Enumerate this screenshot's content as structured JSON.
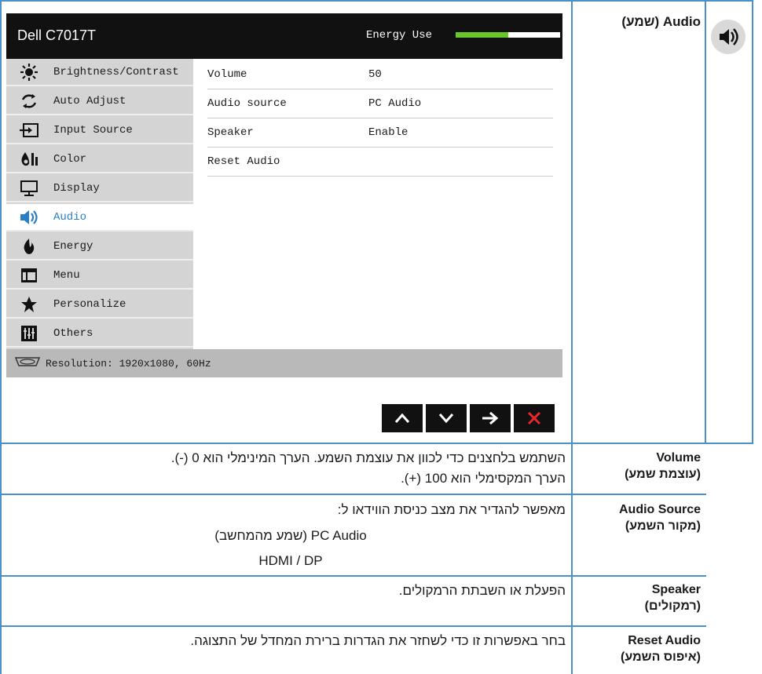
{
  "header": {
    "title": "Audio (שמע)",
    "icon": "speaker-icon"
  },
  "osd": {
    "brand": "Dell C7017T",
    "energy_label": "Energy Use",
    "energy_level": 0.5,
    "accent": "#6ac62a",
    "menu": [
      {
        "label": "Brightness/Contrast",
        "icon": "brightness-icon"
      },
      {
        "label": "Auto Adjust",
        "icon": "auto-adjust-icon"
      },
      {
        "label": "Input Source",
        "icon": "input-source-icon"
      },
      {
        "label": "Color",
        "icon": "color-icon"
      },
      {
        "label": "Display",
        "icon": "display-icon"
      },
      {
        "label": "Audio",
        "icon": "audio-icon",
        "active": true
      },
      {
        "label": "Energy",
        "icon": "energy-icon"
      },
      {
        "label": "Menu",
        "icon": "menu-icon"
      },
      {
        "label": "Personalize",
        "icon": "star-icon"
      },
      {
        "label": "Others",
        "icon": "sliders-icon"
      }
    ],
    "submenu": [
      {
        "label": "Volume",
        "value": "50"
      },
      {
        "label": "Audio source",
        "value": "PC Audio"
      },
      {
        "label": "Speaker",
        "value": "Enable"
      },
      {
        "label": "Reset Audio",
        "value": ""
      }
    ],
    "status": "Resolution: 1920x1080, 60Hz",
    "nav": [
      "up-arrow-icon",
      "down-arrow-icon",
      "right-arrow-icon",
      "close-icon"
    ]
  },
  "rows": [
    {
      "label": [
        "Volume",
        "(עוצמת שמע)"
      ],
      "text": [
        "השתמש בלחצנים כדי לכוון את עוצמת השמע. הערך המינימלי הוא 0 (-).",
        "הערך המקסימלי הוא 100 (+)."
      ]
    },
    {
      "label": [
        "Audio Source",
        "(מקור השמע)"
      ],
      "text": [
        "מאפשר להגדיר את מצב כניסת הווידאו ל:"
      ],
      "options": [
        "PC Audio (שמע מהמחשב)",
        "HDMI / DP"
      ]
    },
    {
      "label": [
        "Speaker",
        "(רמקולים)"
      ],
      "text": [
        "הפעלת או השבתת הרמקולים."
      ]
    },
    {
      "label": [
        "Reset Audio",
        "(איפוס השמע)"
      ],
      "text": [
        "בחר באפשרות זו כדי לשחזר את הגדרות ברירת המחדל של התצוגה."
      ]
    }
  ]
}
